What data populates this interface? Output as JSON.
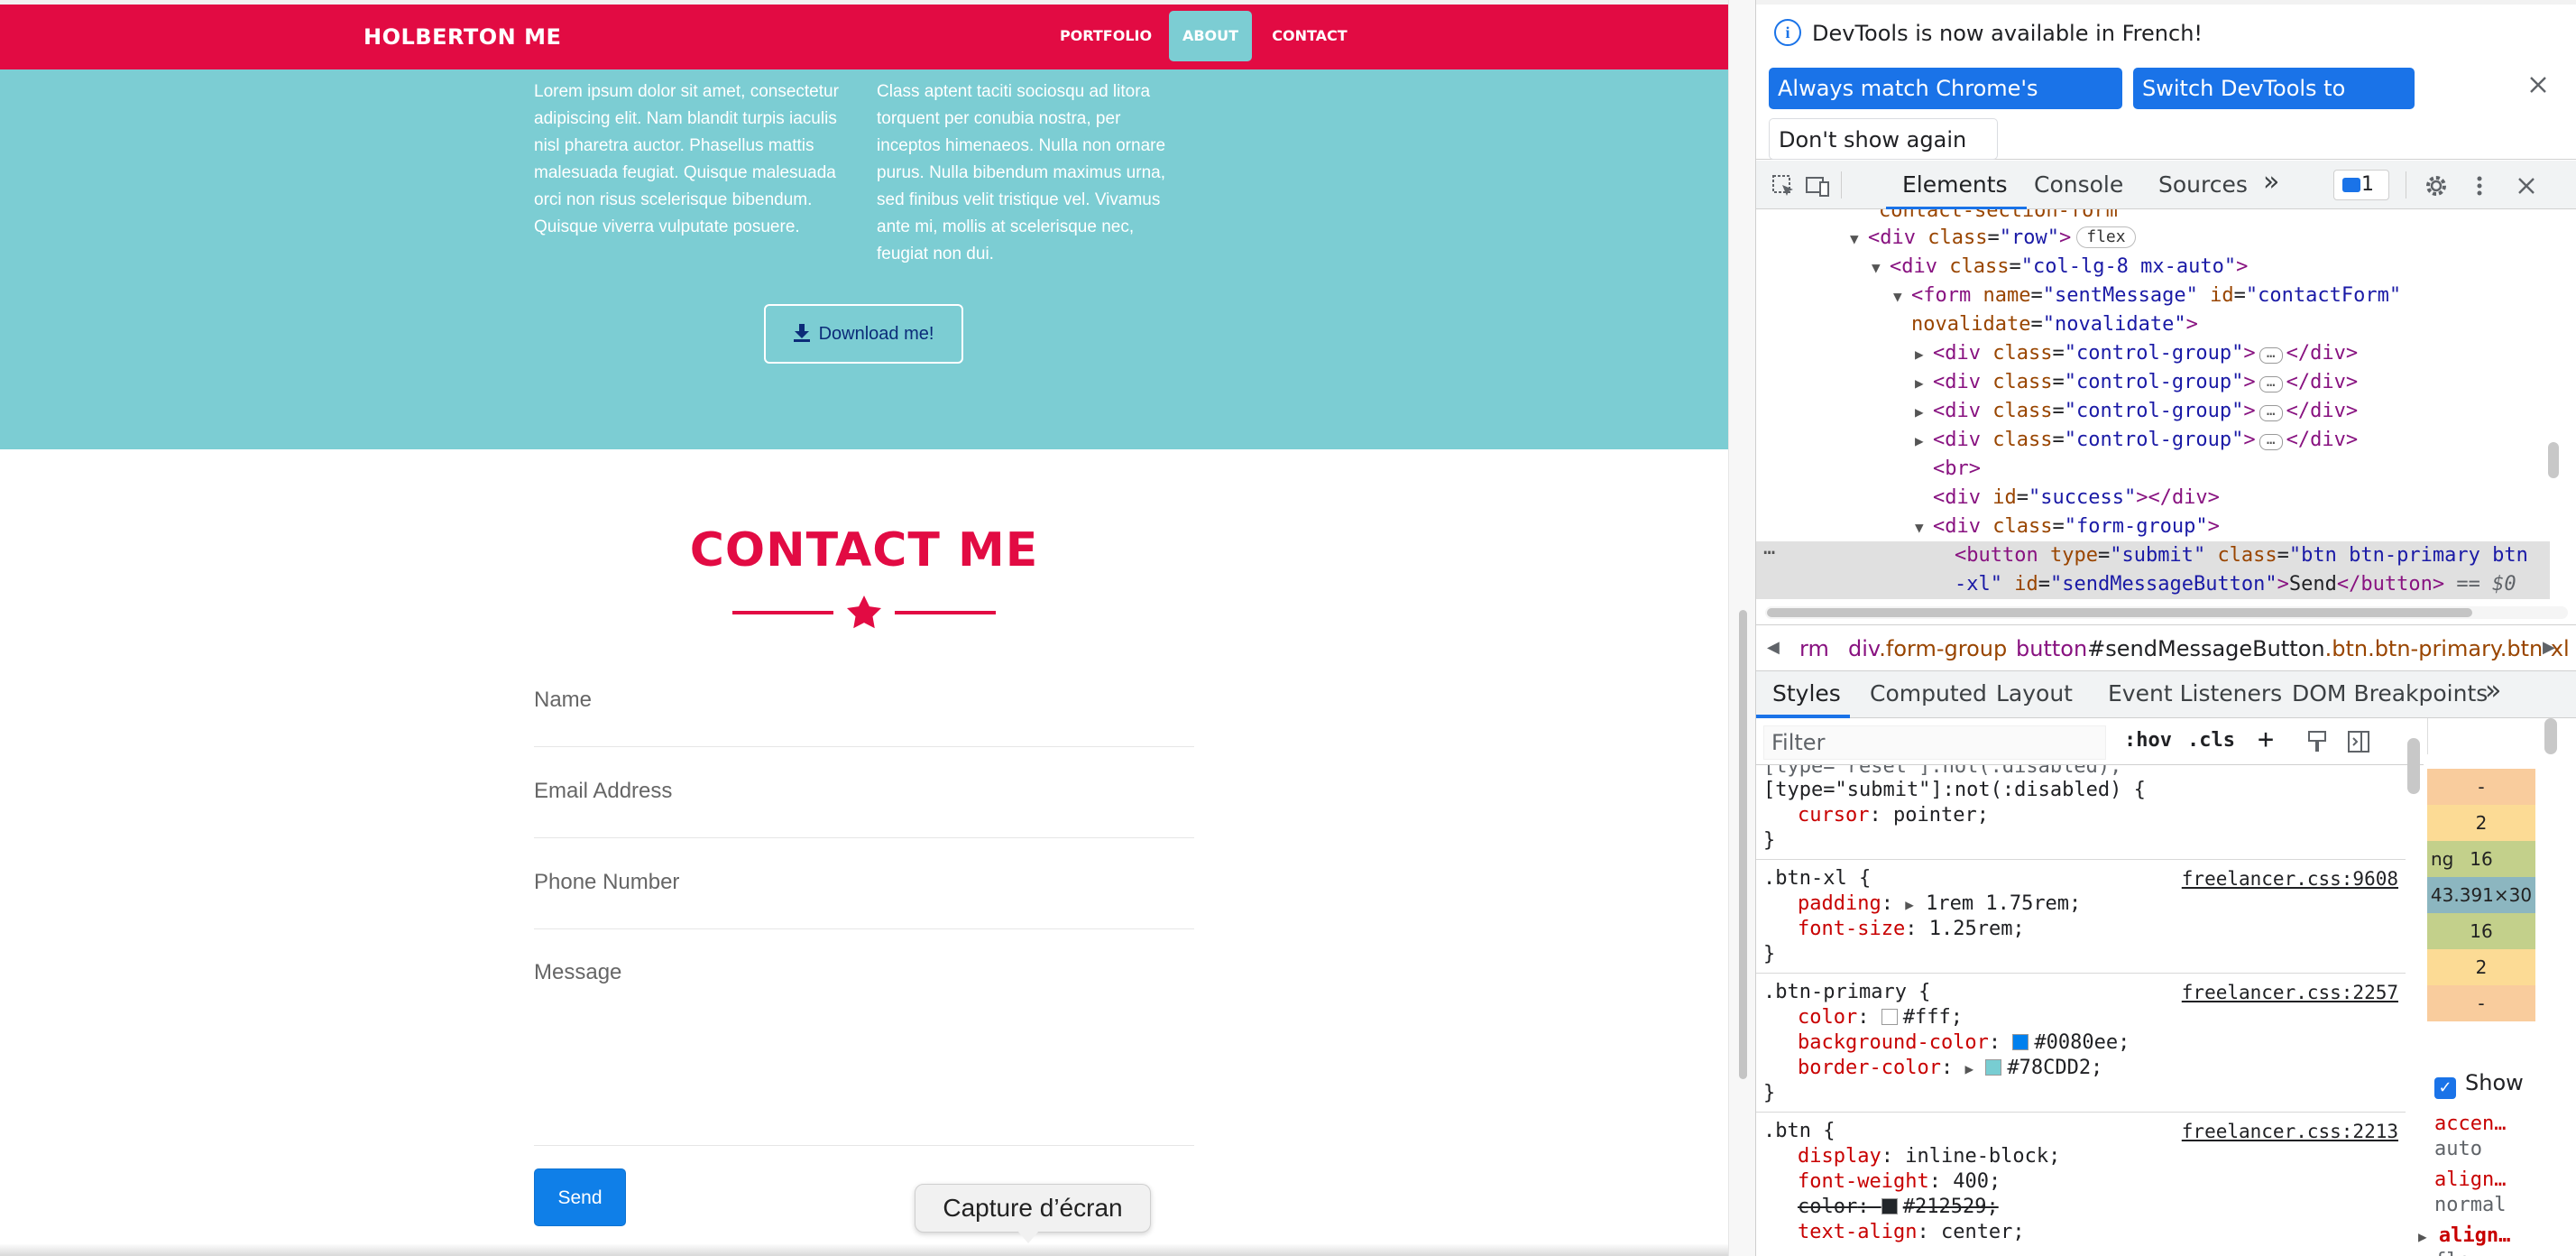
{
  "site": {
    "brand": "HOLBERTON ME",
    "nav": [
      "PORTFOLIO",
      "ABOUT",
      "CONTACT"
    ],
    "about_col1": [
      "Lorem ipsum dolor sit amet, consectetur",
      "adipiscing elit. Nam blandit turpis iaculis",
      "nisl pharetra auctor. Phasellus mattis",
      "malesuada feugiat. Quisque malesuada",
      "orci non risus scelerisque bibendum.",
      "Quisque viverra vulputate posuere."
    ],
    "about_col2": [
      "Class aptent taciti sociosqu ad litora",
      "torquent per conubia nostra, per",
      "inceptos himenaeos. Nulla non ornare",
      "purus. Nulla bibendum maximus urna,",
      "sed finibus velit tristique vel. Vivamus",
      "ante mi, mollis at scelerisque nec,",
      "feugiat non dui."
    ],
    "download_label": "Download me!",
    "contact_title": "CONTACT ME",
    "fields": {
      "name": "Name",
      "email": "Email Address",
      "phone": "Phone Number",
      "message": "Message"
    },
    "send_label": "Send",
    "tooltip": "Capture d’écran",
    "colors": {
      "primary": "#e20b43",
      "teal": "#7ccdd3",
      "button": "#0f7fe8"
    }
  },
  "devtools": {
    "info_text": "DevTools is now available in French!",
    "info_buttons": [
      "Always match Chrome's language",
      "Switch DevTools to French",
      "Don't show again"
    ],
    "tabs": [
      "Elements",
      "Console",
      "Sources"
    ],
    "more_tabs": "»",
    "message_count": "1",
    "dom": {
      "l0": "contact-section-form",
      "row_tag": "div",
      "row_attr": "class",
      "row_val": "row",
      "flex": "flex",
      "col_val": "col-lg-8 mx-auto",
      "form_name": "sentMessage",
      "form_id": "contactForm",
      "novalidate": "novalidate",
      "control_group": "control-group",
      "br": "<br>",
      "success": "success",
      "form_group": "form-group",
      "btn_type": "submit",
      "btn_class": "btn btn-primary btn",
      "btn_class2": "-xl",
      "btn_id": "sendMessageButton",
      "btn_text": "Send",
      "dollar": "== $0"
    },
    "breadcrumbs": {
      "c1": "rm",
      "c2_tag": "div",
      "c2_cls": ".form-group",
      "c3_tag": "button",
      "c3_id": "#sendMessageButton",
      "c3_cls": ".btn.btn-primary.btn-xl"
    },
    "style_tabs": [
      "Styles",
      "Computed",
      "Layout",
      "Event Listeners",
      "DOM Breakpoints"
    ],
    "filter_placeholder": "Filter",
    "filter_tools": [
      ":hov",
      ".cls",
      "+"
    ],
    "rules": {
      "r0_sel1": "[type=\"reset\"]:not(:disabled),",
      "r0_sel2": "[type=\"submit\"]:not(:disabled) {",
      "r0_prop": "cursor",
      "r0_val": "pointer;",
      "close": "}",
      "r1_sel": ".btn-xl {",
      "r1_src": "freelancer.css:9608",
      "r1_p1": "padding",
      "r1_v1": "1rem 1.75rem;",
      "r1_p2": "font-size",
      "r1_v2": "1.25rem;",
      "r2_sel": ".btn-primary {",
      "r2_src": "freelancer.css:2257",
      "r2_p1": "color",
      "r2_v1": "#fff;",
      "r2_p2": "background-color",
      "r2_v2": "#0080ee;",
      "r2_p3": "border-color",
      "r2_v3": "#78CDD2;",
      "r3_sel": ".btn {",
      "r3_src": "freelancer.css:2213",
      "r3_p1": "display",
      "r3_v1": "inline-block;",
      "r3_p2": "font-weight",
      "r3_v2": "400;",
      "r3_p3": "color",
      "r3_v3": "#212529;",
      "r3_p4": "text-align",
      "r3_v4": "center;"
    },
    "boxmodel": [
      "-",
      "2",
      "16",
      "43.391×30",
      "16",
      "2",
      "-"
    ],
    "boxmodel_label": "ng",
    "show_label": "Show",
    "computed": {
      "p1": "accen…",
      "v1": "auto",
      "p2": "align…",
      "v2": "normal",
      "p3": "align…",
      "v3": "flex-…"
    }
  }
}
